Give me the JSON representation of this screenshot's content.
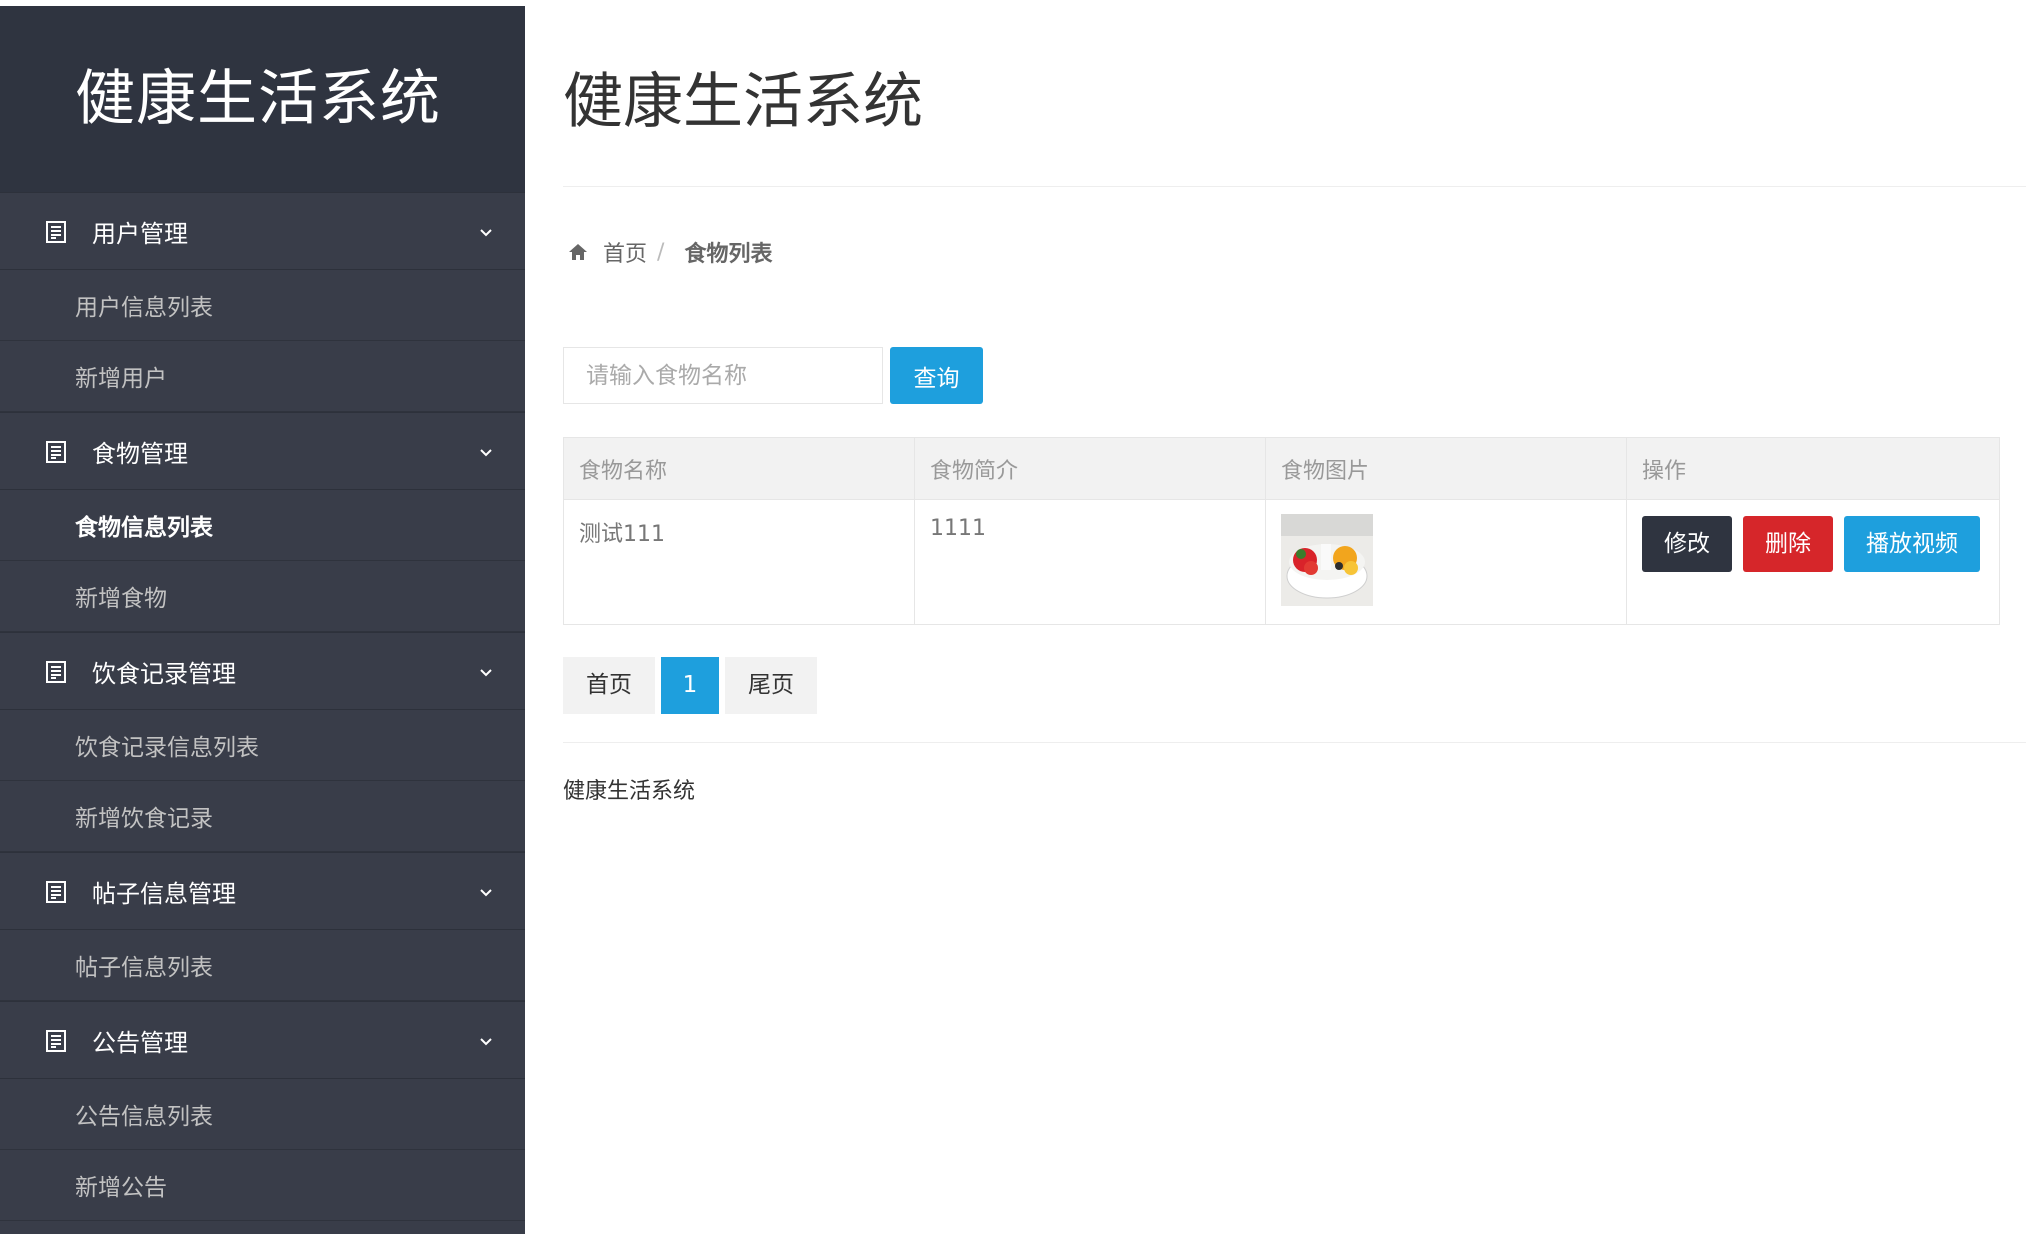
{
  "sidebar": {
    "brand": "健康生活系统",
    "groups": [
      {
        "label": "用户管理",
        "items": [
          "用户信息列表",
          "新增用户"
        ]
      },
      {
        "label": "食物管理",
        "items": [
          "食物信息列表",
          "新增食物"
        ]
      },
      {
        "label": "饮食记录管理",
        "items": [
          "饮食记录信息列表",
          "新增饮食记录"
        ]
      },
      {
        "label": "帖子信息管理",
        "items": [
          "帖子信息列表"
        ]
      },
      {
        "label": "公告管理",
        "items": [
          "公告信息列表",
          "新增公告"
        ]
      }
    ],
    "active_item": "食物信息列表"
  },
  "main": {
    "title": "健康生活系统",
    "breadcrumb": {
      "home": "首页",
      "separator": "/",
      "current": "食物列表"
    },
    "search": {
      "placeholder": "请输入食物名称",
      "button": "查询"
    },
    "table": {
      "headers": [
        "食物名称",
        "食物简介",
        "食物图片",
        "操作"
      ],
      "rows": [
        {
          "name": "测试111",
          "intro": "1111",
          "image": "food-thumbnail"
        }
      ],
      "actions": {
        "edit": "修改",
        "delete": "删除",
        "video": "播放视频"
      }
    },
    "pager": {
      "first": "首页",
      "current": "1",
      "last": "尾页"
    },
    "footer": "健康生活系统"
  },
  "colors": {
    "sidebar_bg": "#393d49",
    "brand_bg": "#2f3440",
    "accent_blue": "#1e9fdd",
    "danger_red": "#d6262a",
    "dark_button": "#2f3440"
  },
  "icons": {
    "nav_group": "document-icon",
    "nav_expand": "chevron-down-icon",
    "breadcrumb_home": "home-icon"
  }
}
